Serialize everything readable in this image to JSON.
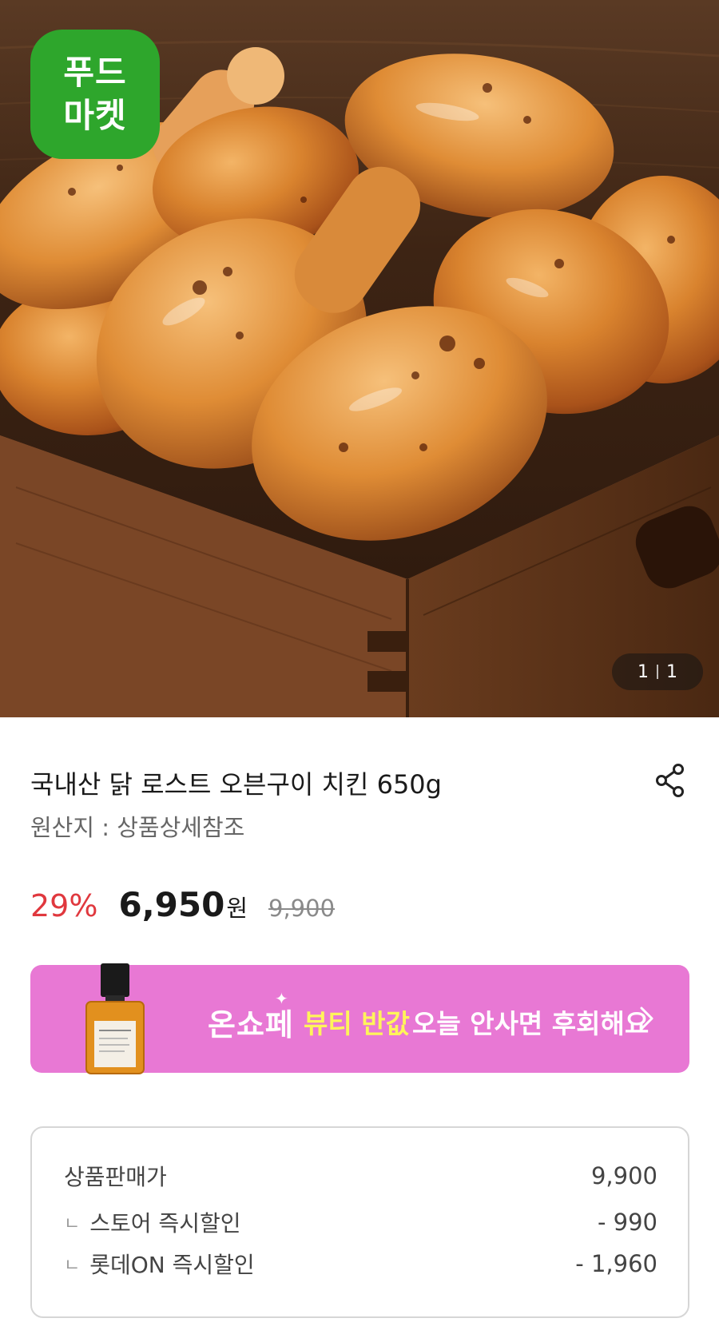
{
  "brand_badge": {
    "line1": "푸드",
    "line2": "마켓"
  },
  "image_indicator": {
    "current": "1",
    "total": "1"
  },
  "product": {
    "title": "국내산 닭 로스트 오븐구이 치킨 650g",
    "origin": "원산지 : 상품상세참조"
  },
  "price": {
    "discount": "29%",
    "sale": "6,950",
    "currency": "원",
    "original": "9,900"
  },
  "banner": {
    "logo": "온쇼페",
    "highlight": "뷰티 반값",
    "text": "오늘 안사면 후회해요"
  },
  "breakdown": {
    "rows": [
      {
        "label": "상품판매가",
        "value": "9,900"
      },
      {
        "label": "스토어 즉시할인",
        "value": "- 990"
      },
      {
        "label": "롯데ON 즉시할인",
        "value": "- 1,960"
      }
    ]
  },
  "colors": {
    "brand_green": "#2ea62c",
    "discount_red": "#e0383e",
    "banner_pink": "#e878d4",
    "banner_yellow": "#fff45a"
  },
  "icons": {
    "share": "share-icon",
    "chevron": "chevron-right-icon",
    "sub_marker": "corner-marker-icon"
  }
}
